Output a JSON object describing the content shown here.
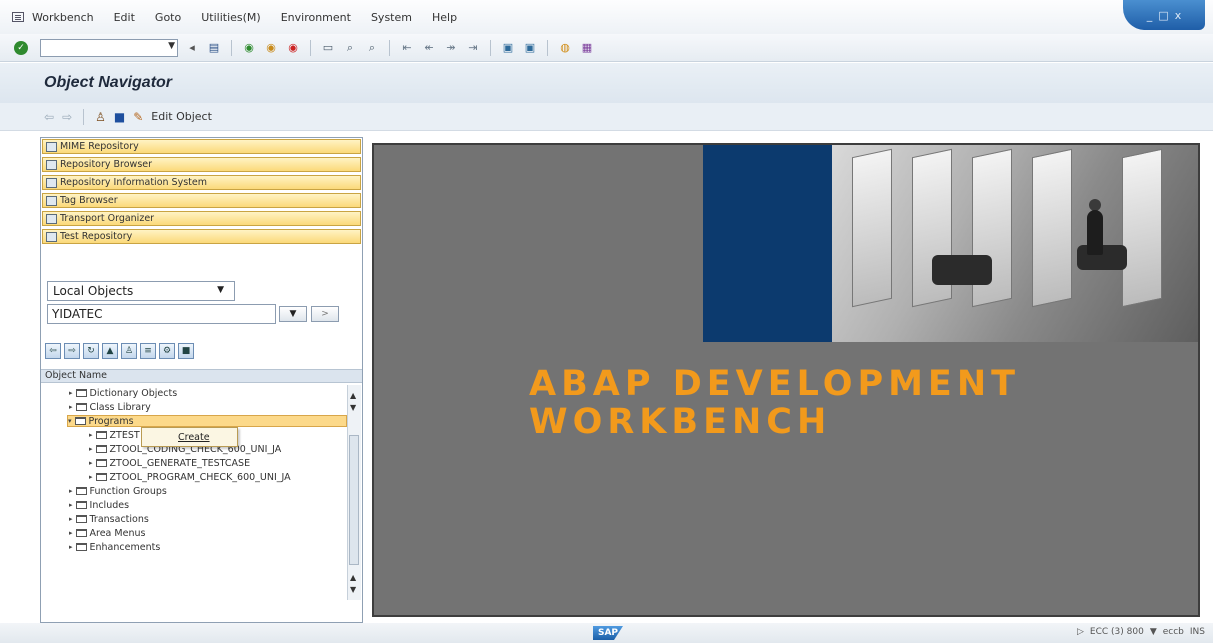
{
  "menubar": {
    "items": [
      "Workbench",
      "Edit",
      "Goto",
      "Utilities(M)",
      "Environment",
      "System",
      "Help"
    ],
    "window_controls": [
      "_",
      "□",
      "x"
    ]
  },
  "toolbar": {
    "command_value": "",
    "icons": [
      "check-icon",
      "back-icon",
      "save-icon",
      "green-back-icon",
      "exit-icon",
      "cancel-icon",
      "print-icon",
      "find-icon",
      "find-next-icon",
      "first-page-icon",
      "prev-page-icon",
      "next-page-icon",
      "last-page-icon",
      "new-session-icon",
      "shortcut-icon",
      "help-icon",
      "layout-icon"
    ]
  },
  "title": "Object Navigator",
  "app_toolbar": {
    "edit_label": "Edit Object"
  },
  "nav_buttons": [
    "MIME Repository",
    "Repository Browser",
    "Repository Information System",
    "Tag Browser",
    "Transport Organizer",
    "Test Repository"
  ],
  "object_selector": {
    "type": "Local Objects",
    "name": "YIDATEC"
  },
  "tree": {
    "header": "Object Name",
    "items": [
      {
        "label": "Dictionary Objects",
        "level": 1
      },
      {
        "label": "Class Library",
        "level": 1
      },
      {
        "label": "Programs",
        "level": 1
      },
      {
        "label": "ZTEST",
        "level": 2
      },
      {
        "label": "ZTOOL_CODING_CHECK_600_UNI_JA",
        "level": 2
      },
      {
        "label": "ZTOOL_GENERATE_TESTCASE",
        "level": 2
      },
      {
        "label": "ZTOOL_PROGRAM_CHECK_600_UNI_JA",
        "level": 2
      },
      {
        "label": "Function Groups",
        "level": 1
      },
      {
        "label": "Includes",
        "level": 1
      },
      {
        "label": "Transactions",
        "level": 1
      },
      {
        "label": "Area Menus",
        "level": 1
      },
      {
        "label": "Enhancements",
        "level": 1
      }
    ],
    "context_menu": "Create"
  },
  "banner": {
    "line1": "ABAP DEVELOPMENT",
    "line2": "WORKBENCH"
  },
  "statusbar": {
    "logo": "SAP",
    "system": "ECC (3) 800",
    "client": "eccb",
    "mode": "INS"
  }
}
